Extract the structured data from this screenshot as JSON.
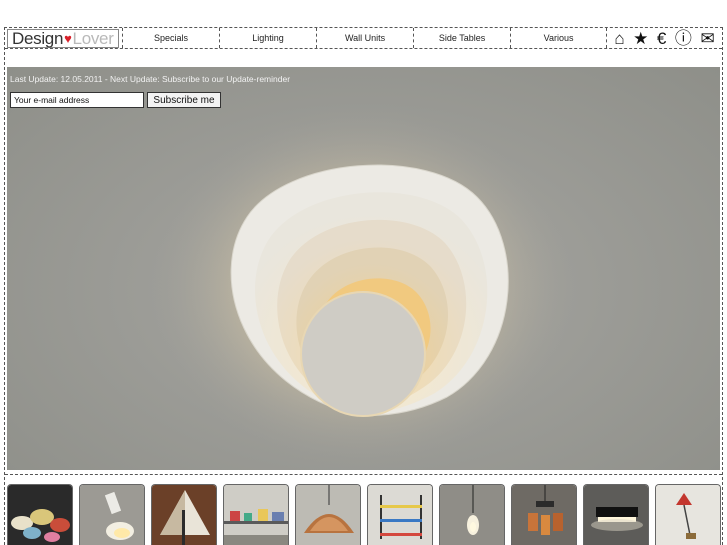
{
  "logo": {
    "part1": "Design",
    "heart": "♥",
    "part2": "Lover"
  },
  "nav": {
    "items": [
      {
        "label": "Specials"
      },
      {
        "label": "Lighting"
      },
      {
        "label": "Wall Units"
      },
      {
        "label": "Side Tables"
      },
      {
        "label": "Various"
      }
    ]
  },
  "toolbar_icons": [
    {
      "name": "home-icon",
      "glyph": "⌂"
    },
    {
      "name": "star-icon",
      "glyph": "★"
    },
    {
      "name": "euro-icon",
      "glyph": "€"
    },
    {
      "name": "info-icon",
      "glyph": "ⓘ"
    },
    {
      "name": "mail-icon",
      "glyph": "✉"
    }
  ],
  "hero": {
    "update_text": "Last Update: 12.05.2011 - Next Update: Subscribe to our Update-reminder",
    "email_placeholder": "Your e-mail address",
    "subscribe_label": "Subscribe me"
  },
  "thumbnails": [
    {
      "name": "thumb-ceramic-bowls"
    },
    {
      "name": "thumb-white-spot-lamp"
    },
    {
      "name": "thumb-copper-cone-lamp"
    },
    {
      "name": "thumb-shelf-display"
    },
    {
      "name": "thumb-copper-pendant"
    },
    {
      "name": "thumb-string-shelf"
    },
    {
      "name": "thumb-glass-pendant"
    },
    {
      "name": "thumb-amber-cascade-lamp"
    },
    {
      "name": "thumb-black-wall-light"
    },
    {
      "name": "thumb-red-flower-lamp"
    }
  ]
}
